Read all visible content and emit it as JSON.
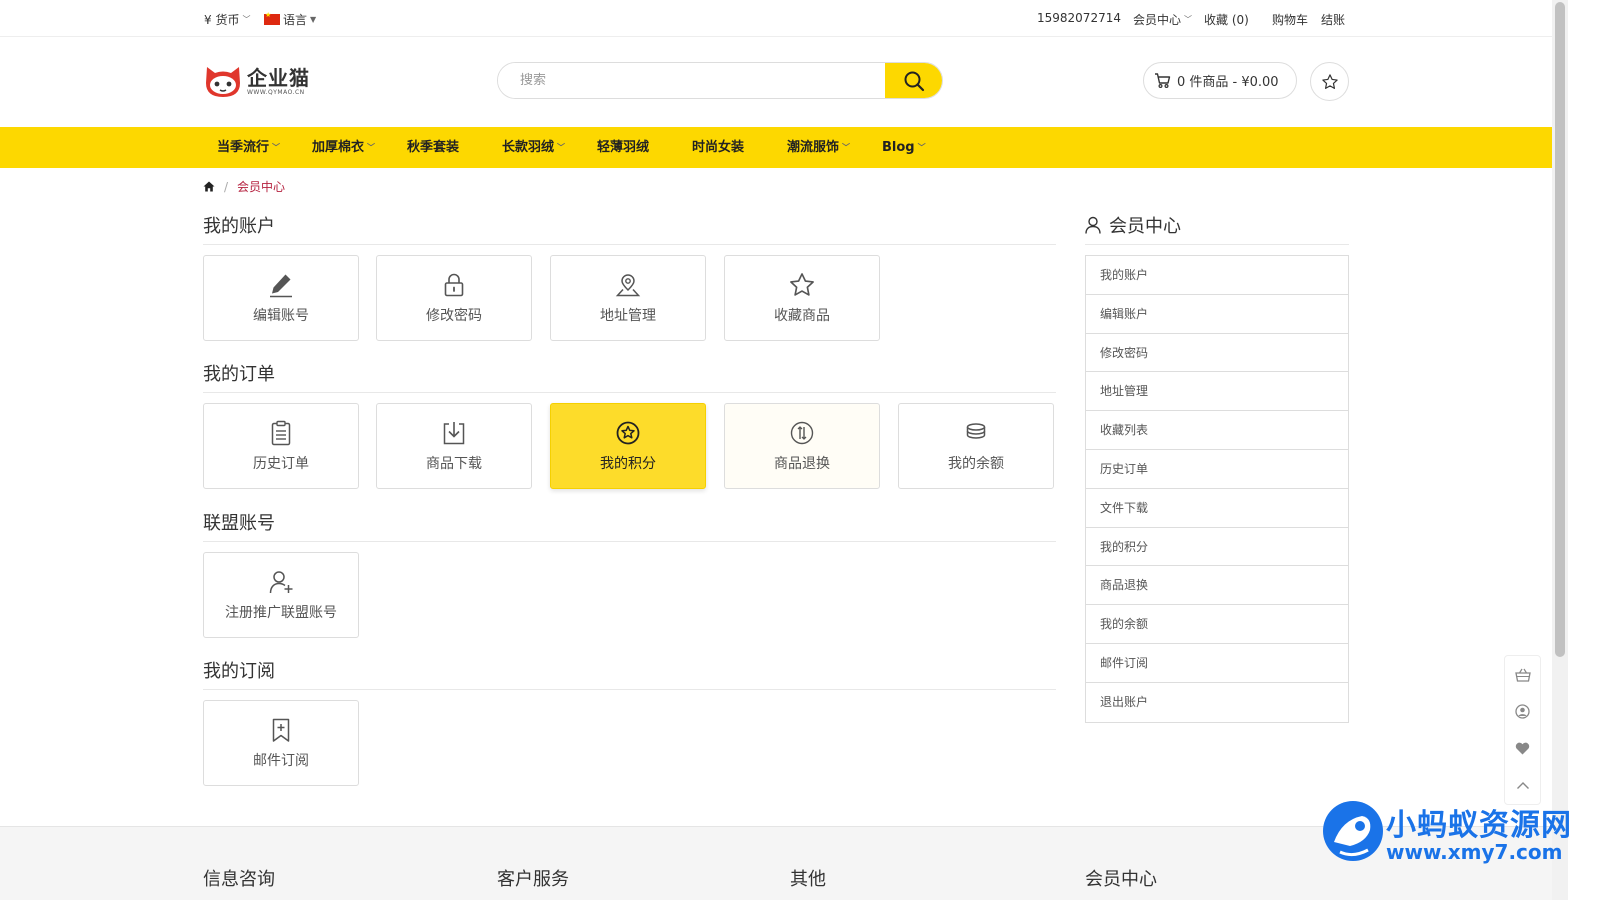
{
  "topbar": {
    "currency": "¥ 货币",
    "language": "语言",
    "phone": "15982072714",
    "member_center": "会员中心",
    "favorites": "收藏 (0)",
    "cart": "购物车",
    "checkout": "结账"
  },
  "header": {
    "logo_name": "企业猫",
    "logo_url": "WWW.QYMAO.CN",
    "search_placeholder": "搜索",
    "cart_summary": "0 件商品 - ¥0.00"
  },
  "nav": {
    "items": [
      {
        "label": "当季流行",
        "dropdown": true
      },
      {
        "label": "加厚棉衣",
        "dropdown": true
      },
      {
        "label": "秋季套装",
        "dropdown": false
      },
      {
        "label": "长款羽绒",
        "dropdown": true
      },
      {
        "label": "轻薄羽绒",
        "dropdown": false
      },
      {
        "label": "时尚女装",
        "dropdown": false
      },
      {
        "label": "潮流服饰",
        "dropdown": true
      },
      {
        "label": "Blog",
        "dropdown": true
      }
    ]
  },
  "breadcrumb": {
    "current": "会员中心"
  },
  "account": {
    "title": "我的账户",
    "tiles": [
      {
        "label": "编辑账号",
        "icon": "pencil-icon"
      },
      {
        "label": "修改密码",
        "icon": "lock-icon"
      },
      {
        "label": "地址管理",
        "icon": "location-icon"
      },
      {
        "label": "收藏商品",
        "icon": "star-icon"
      }
    ]
  },
  "orders": {
    "title": "我的订单",
    "tiles": [
      {
        "label": "历史订单",
        "icon": "clipboard-icon"
      },
      {
        "label": "商品下载",
        "icon": "download-icon"
      },
      {
        "label": "我的积分",
        "icon": "points-star-icon"
      },
      {
        "label": "商品退换",
        "icon": "return-icon"
      },
      {
        "label": "我的余额",
        "icon": "coins-icon"
      }
    ]
  },
  "affiliate": {
    "title": "联盟账号",
    "tiles": [
      {
        "label": "注册推广联盟账号",
        "icon": "user-add-icon"
      }
    ]
  },
  "subscription": {
    "title": "我的订阅",
    "tiles": [
      {
        "label": "邮件订阅",
        "icon": "bookmark-icon"
      }
    ]
  },
  "sidebar": {
    "title": "会员中心",
    "items": [
      {
        "label": "我的账户"
      },
      {
        "label": "编辑账户"
      },
      {
        "label": "修改密码"
      },
      {
        "label": "地址管理"
      },
      {
        "label": "收藏列表"
      },
      {
        "label": "历史订单"
      },
      {
        "label": "文件下载"
      },
      {
        "label": "我的积分"
      },
      {
        "label": "商品退换"
      },
      {
        "label": "我的余额"
      },
      {
        "label": "邮件订阅"
      },
      {
        "label": "退出账户"
      }
    ]
  },
  "footer": {
    "headings": [
      "信息咨询",
      "客户服务",
      "其他",
      "会员中心"
    ]
  },
  "watermark": {
    "name": "小蚂蚁资源网",
    "url": "www.xmy7.com"
  },
  "colors": {
    "accent": "#fdd800",
    "breadcrumb_active": "#b5213f",
    "watermark": "#1a73e8"
  }
}
